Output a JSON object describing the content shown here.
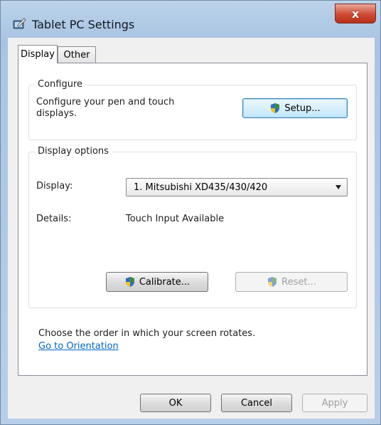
{
  "window": {
    "title": "Tablet PC Settings",
    "close_glyph": "x",
    "close_color": "#cf4a32"
  },
  "tabs": [
    {
      "label": "Display",
      "active": true
    },
    {
      "label": "Other",
      "active": false
    }
  ],
  "configure": {
    "legend": "Configure",
    "description_line1": "Configure your pen and touch",
    "description_line2": "displays.",
    "setup_button": {
      "label": "Setup...",
      "icon": "uac-shield-icon"
    }
  },
  "display_options": {
    "legend": "Display options",
    "display_label": "Display:",
    "display_value": "1. Mitsubishi XD435/430/420",
    "details_label": "Details:",
    "details_value": "Touch Input Available",
    "calibrate_button": {
      "label": "Calibrate...",
      "icon": "uac-shield-icon"
    },
    "reset_button": {
      "label": "Reset...",
      "icon": "uac-shield-icon",
      "enabled": false
    }
  },
  "orientation": {
    "text": "Choose the order in which your screen rotates.",
    "link": "Go to Orientation"
  },
  "footer": {
    "ok": "OK",
    "cancel": "Cancel",
    "apply": "Apply"
  },
  "colors": {
    "link": "#0066cc",
    "focus_border": "#3c7fb1"
  }
}
